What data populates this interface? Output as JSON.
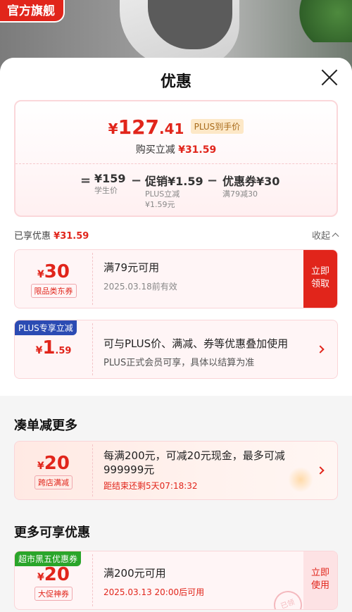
{
  "header": {
    "flagship_label": "官方旗舰"
  },
  "sheet": {
    "title": "优惠"
  },
  "price": {
    "currency": "¥",
    "integer": "127",
    "decimal": ".41",
    "plus_tag": "PLUS到手价",
    "buy_reduce_label": "购买立减",
    "buy_reduce_value": "¥31.59",
    "formula": {
      "eq": "=",
      "base_value": "¥159",
      "base_label": "学生价",
      "minus1": "−",
      "promo_value": "促销¥1.59",
      "promo_label1": "PLUS立减",
      "promo_label2": "¥1.59元",
      "minus2": "−",
      "coupon_value": "优惠券¥30",
      "coupon_label": "满79减30"
    }
  },
  "enjoyed": {
    "label": "已享优惠",
    "value": "¥31.59",
    "collapse_label": "收起"
  },
  "coupons": [
    {
      "currency": "¥",
      "amount": "30",
      "decimal": "",
      "tag": "限品类东券",
      "title": "满79元可用",
      "subtitle": "2025.03.18前有效",
      "action_line1": "立即",
      "action_line2": "领取"
    },
    {
      "badge": "PLUS专享立减",
      "currency": "¥",
      "amount": "1",
      "decimal": ".59",
      "title": "可与PLUS价、满减、券等优惠叠加使用",
      "subtitle": "PLUS正式会员可享，具体以结算为准"
    }
  ],
  "section_more_deals": {
    "title": "凑单减更多",
    "card": {
      "currency": "¥",
      "amount": "20",
      "tag": "跨店满减",
      "title": "每满200元，可减20元现金，最多可减999999元",
      "countdown": "距结束还剩5天07:18:32"
    }
  },
  "section_more_offers": {
    "title": "更多可享优惠",
    "card": {
      "badge": "超市黑五优惠券",
      "currency": "¥",
      "amount": "20",
      "tag": "大促神券",
      "title": "满200元可用",
      "subtitle": "2025.03.13 20:00后可用",
      "action_line1": "立即",
      "action_line2": "使用",
      "stamp": "已领"
    }
  },
  "colors": {
    "accent": "#e1251b",
    "plus_badge": "#2b4bb3",
    "green_badge": "#2aa52a"
  }
}
